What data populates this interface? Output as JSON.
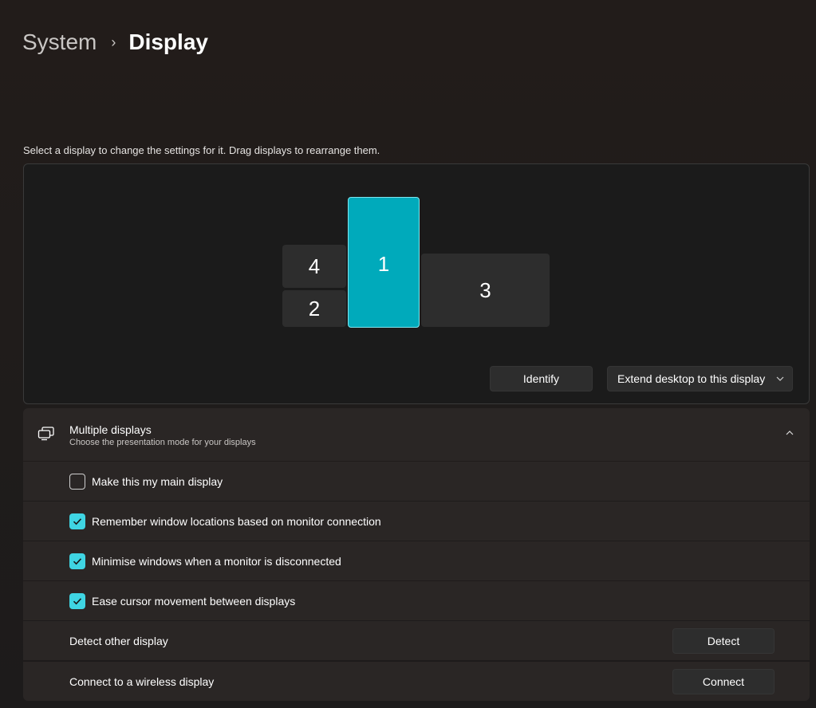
{
  "breadcrumb": {
    "parent": "System",
    "separator": "›",
    "current": "Display"
  },
  "instruction": "Select a display to change the settings for it. Drag displays to rearrange them.",
  "monitors": [
    {
      "id": "1",
      "selected": true
    },
    {
      "id": "4",
      "selected": false
    },
    {
      "id": "2",
      "selected": false
    },
    {
      "id": "3",
      "selected": false
    }
  ],
  "buttons": {
    "identify": "Identify",
    "extend": "Extend desktop to this display",
    "detect": "Detect",
    "connect": "Connect"
  },
  "multiple_displays": {
    "title": "Multiple displays",
    "subtitle": "Choose the presentation mode for your displays",
    "expanded": true,
    "options": [
      {
        "label": "Make this my main display",
        "checked": false
      },
      {
        "label": "Remember window locations based on monitor connection",
        "checked": true
      },
      {
        "label": "Minimise windows when a monitor is disconnected",
        "checked": true
      },
      {
        "label": "Ease cursor movement between displays",
        "checked": true
      }
    ],
    "detect_label": "Detect other display",
    "wireless_label": "Connect to a wireless display"
  },
  "colors": {
    "accent": "#00aabb",
    "checkbox_accent": "#3fd5e3",
    "card_bg": "#2a2625",
    "panel_bg": "#1b1b1b"
  }
}
